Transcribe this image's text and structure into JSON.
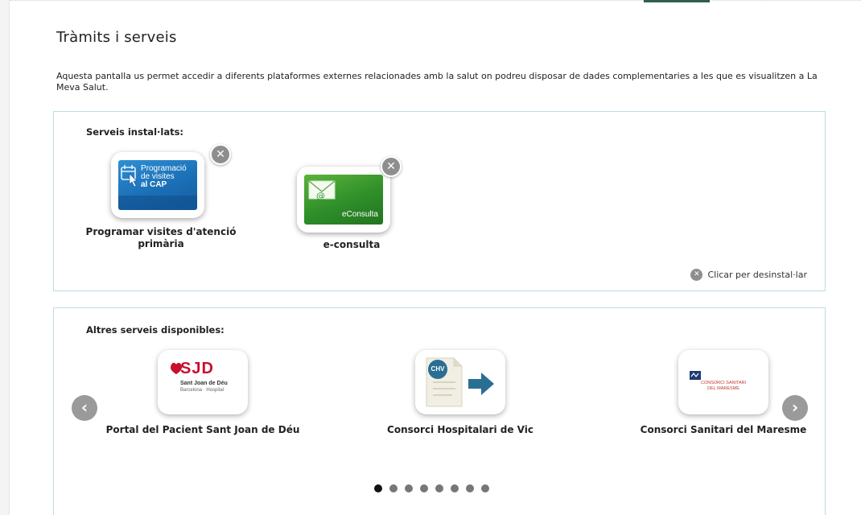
{
  "page": {
    "title": "Tràmits i serveis",
    "intro": "Aquesta pantalla us permet accedir a diferents plataformes externes relacionades amb la salut on podreu disposar de dades complementaries a les que es visualitzen a La Meva Salut."
  },
  "installed": {
    "heading": "Serveis instal·lats:",
    "services": [
      {
        "label": "Programar visites d'atenció primària",
        "tile_text": [
          "Programació",
          "de visites",
          "al CAP"
        ],
        "icon": "calendar-cursor-icon",
        "color": "#1b6fb6"
      },
      {
        "label": "e-consulta",
        "tile_text": [
          "eConsulta"
        ],
        "icon": "envelope-at-icon",
        "color": "#2f8e2a"
      }
    ],
    "remove_symbol": "✕",
    "hint": "Clicar per desinstal·lar"
  },
  "available": {
    "heading": "Altres serveis disponibles:",
    "services": [
      {
        "label": "Portal del Pacient Sant Joan de Déu",
        "logo_main": "SJD",
        "logo_line1": "Sant Joan de Déu",
        "logo_line2": "Barcelona · Hospital",
        "accent": "#c8102e"
      },
      {
        "label": "Consorci Hospitalari de Vic",
        "badge": "CHV",
        "icon": "document-arrow-icon",
        "accent": "#2a6f93"
      },
      {
        "label": "Consorci Sanitari del Maresme",
        "logo_line1": "CONSORCI SANITARI",
        "logo_line2": "DEL MARESME",
        "icon": "maresme-logo-icon",
        "accent": "#c0392b"
      }
    ],
    "carousel": {
      "current_page": 1,
      "total_pages": 8
    }
  }
}
